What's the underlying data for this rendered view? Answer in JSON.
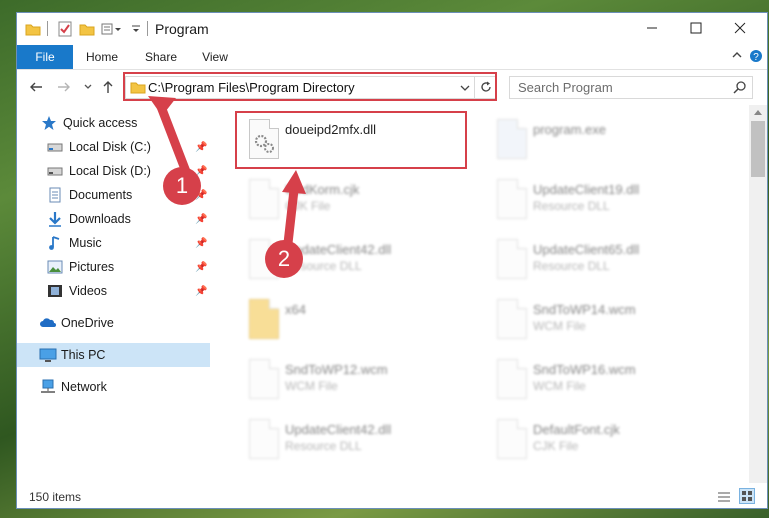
{
  "window": {
    "title": "Program",
    "ribbon_tabs": [
      "File",
      "Home",
      "Share",
      "View"
    ]
  },
  "address_bar": {
    "path": "C:\\Program Files\\Program Directory"
  },
  "search": {
    "placeholder": "Search Program"
  },
  "sidebar": {
    "items": [
      {
        "label": "Quick access",
        "icon": "star-icon"
      },
      {
        "label": "Local Disk (C:)",
        "icon": "drive-icon",
        "pinned": true
      },
      {
        "label": "Local Disk (D:)",
        "icon": "drive-icon",
        "pinned": true
      },
      {
        "label": "Documents",
        "icon": "documents-icon",
        "pinned": true
      },
      {
        "label": "Downloads",
        "icon": "download-icon",
        "pinned": true
      },
      {
        "label": "Music",
        "icon": "music-icon",
        "pinned": true
      },
      {
        "label": "Pictures",
        "icon": "pictures-icon",
        "pinned": true
      },
      {
        "label": "Videos",
        "icon": "videos-icon",
        "pinned": true
      },
      {
        "label": "OneDrive",
        "icon": "cloud-icon"
      },
      {
        "label": "This PC",
        "icon": "pc-icon",
        "selected": true
      },
      {
        "label": "Network",
        "icon": "network-icon"
      }
    ]
  },
  "files": [
    {
      "name": "doueipd2mfx.dll",
      "type": "",
      "highlight": true
    },
    {
      "name": "program.exe",
      "type": ""
    },
    {
      "name": "UpdKorm.cjk",
      "type": "CJK File"
    },
    {
      "name": "UpdateClient19.dll",
      "type": "Resource DLL"
    },
    {
      "name": "UpdateClient42.dll",
      "type": "Resource DLL"
    },
    {
      "name": "UpdateClient65.dll",
      "type": "Resource DLL"
    },
    {
      "name": "x64",
      "type": ""
    },
    {
      "name": "SndToWP14.wcm",
      "type": "WCM File"
    },
    {
      "name": "SndToWP12.wcm",
      "type": "WCM File"
    },
    {
      "name": "SndToWP16.wcm",
      "type": "WCM File"
    },
    {
      "name": "UpdateClient42.dll",
      "type": "Resource DLL"
    },
    {
      "name": "DefaultFont.cjk",
      "type": "CJK File"
    }
  ],
  "status": {
    "item_count": "150 items"
  },
  "callouts": [
    "1",
    "2"
  ],
  "colors": {
    "accent": "#1979ca",
    "highlight_red": "#d6404a",
    "selected_bg": "#cce4f7"
  }
}
